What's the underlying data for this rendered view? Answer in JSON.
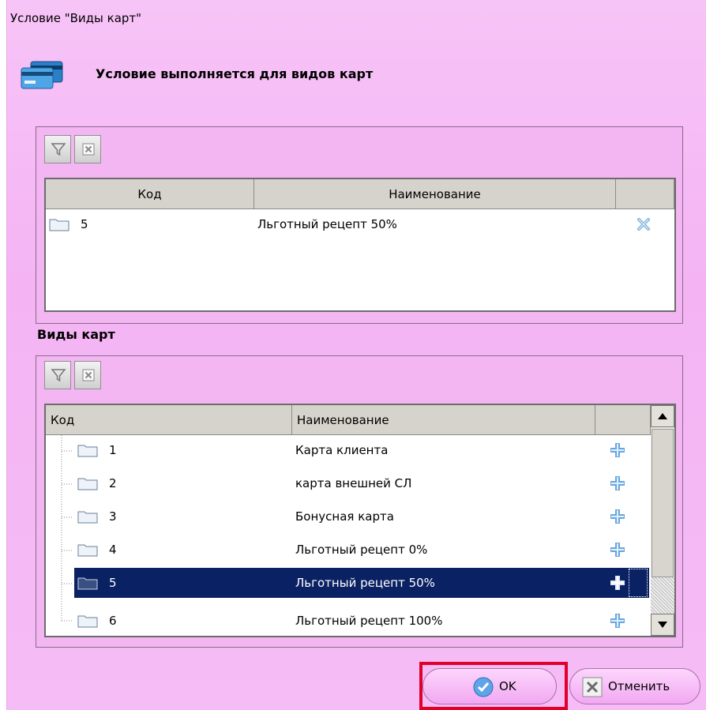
{
  "window": {
    "title": "Условие \"Виды карт\""
  },
  "header": {
    "icon": "credit-cards-icon",
    "text": "Условие выполняется для видов карт"
  },
  "selected_grid": {
    "toolbar": {
      "filter_icon": "filter-icon",
      "clear_filter_icon": "clear-filter-icon"
    },
    "columns": [
      "Код",
      "Наименование",
      ""
    ],
    "rows": [
      {
        "code": "5",
        "name": "Льготный рецепт 50%",
        "action_icon": "remove-icon"
      }
    ]
  },
  "available_section": {
    "label": "Виды карт",
    "toolbar": {
      "filter_icon": "filter-icon",
      "clear_filter_icon": "clear-filter-icon"
    },
    "columns": [
      "Код",
      "Наименование",
      ""
    ],
    "rows": [
      {
        "code": "1",
        "name": "Карта клиента",
        "action_icon": "add-icon",
        "selected": false
      },
      {
        "code": "2",
        "name": "карта внешней СЛ",
        "action_icon": "add-icon",
        "selected": false
      },
      {
        "code": "3",
        "name": "Бонусная карта",
        "action_icon": "add-icon",
        "selected": false
      },
      {
        "code": "4",
        "name": "Льготный рецепт 0%",
        "action_icon": "add-icon",
        "selected": false
      },
      {
        "code": "5",
        "name": "Льготный рецепт 50%",
        "action_icon": "add-icon",
        "selected": true
      },
      {
        "code": "6",
        "name": "Льготный рецепт 100%",
        "action_icon": "add-icon",
        "selected": false
      }
    ]
  },
  "buttons": {
    "ok_label": "OK",
    "cancel_label": "Отменить"
  },
  "colors": {
    "dialog_bg": "#f4b4f4",
    "selection": "#0a2163",
    "highlight": "#e0002a"
  }
}
